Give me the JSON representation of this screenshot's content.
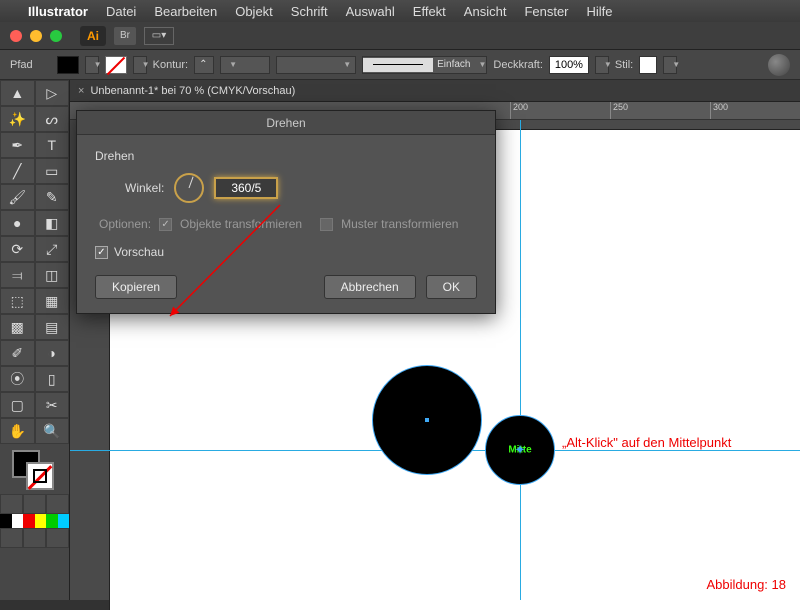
{
  "menubar": {
    "app": "Illustrator",
    "items": [
      "Datei",
      "Bearbeiten",
      "Objekt",
      "Schrift",
      "Auswahl",
      "Effekt",
      "Ansicht",
      "Fenster",
      "Hilfe"
    ]
  },
  "titlebar": {
    "ai": "Ai",
    "br": "Br"
  },
  "control": {
    "type_label": "Pfad",
    "stroke_label": "Kontur:",
    "stroke_weight": "",
    "stroke_profile": "Einfach",
    "opacity_label": "Deckkraft:",
    "opacity_value": "100%",
    "style_label": "Stil:"
  },
  "doc_tab": "Unbenannt-1* bei 70 % (CMYK/Vorschau)",
  "ruler_marks": [
    "200",
    "250",
    "300"
  ],
  "dialog": {
    "title": "Drehen",
    "section": "Drehen",
    "angle_label": "Winkel:",
    "angle_value": "360/5",
    "options_label": "Optionen:",
    "opt_transform_objects": "Objekte transformieren",
    "opt_transform_patterns": "Muster transformieren",
    "preview_label": "Vorschau",
    "btn_copy": "Kopieren",
    "btn_cancel": "Abbrechen",
    "btn_ok": "OK"
  },
  "canvas": {
    "mitte_label": "Mitte",
    "annotation_alt": "„Alt-Klick\" auf den Mittelpunkt",
    "figure_label": "Abbildung: 18"
  }
}
